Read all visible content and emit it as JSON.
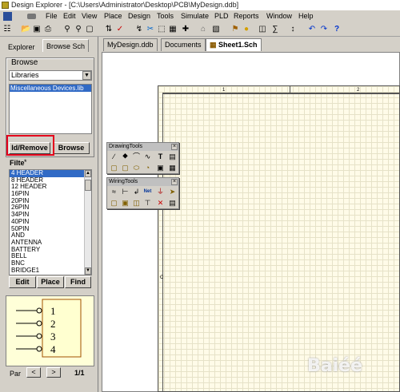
{
  "title": "Design Explorer - [C:\\Users\\Administrator\\Desktop\\PCB\\MyDesign.ddb]",
  "menu": [
    "File",
    "Edit",
    "View",
    "Place",
    "Design",
    "Tools",
    "Simulate",
    "PLD",
    "Reports",
    "Window",
    "Help"
  ],
  "panel": {
    "tabs": [
      "Explorer",
      "Browse Sch"
    ],
    "browse_label": "Browse",
    "libraries_value": "Libraries",
    "library_items": [
      "Miscellaneous Devices.lib"
    ],
    "add_remove_button": "Id/Remove",
    "browse_button": "Browse",
    "filter_label": "Filte",
    "filter_value": "*",
    "components": [
      "4 HEADER",
      "8 HEADER",
      "12 HEADER",
      "16PIN",
      "20PIN",
      "26PIN",
      "34PIN",
      "40PIN",
      "50PIN",
      "AND",
      "ANTENNA",
      "BATTERY",
      "BELL",
      "BNC",
      "BRIDGE1"
    ],
    "edit_button": "Edit",
    "place_button": "Place",
    "find_button": "Find",
    "pins": [
      "1",
      "2",
      "3",
      "4"
    ],
    "part_label": "Par",
    "part_counter": "1/1"
  },
  "doc_tabs": [
    "MyDesign.ddb",
    "Documents",
    "Sheet1.Sch"
  ],
  "palettes": {
    "drawing_title": "DrawingTools",
    "wiring_title": "WiringTools"
  },
  "sheet": {
    "col_markers": [
      "1",
      "2"
    ],
    "row_marker": "C"
  },
  "icons": [
    "app-icon",
    "open-icon",
    "save-icon",
    "print-icon",
    "zoom-in-icon",
    "zoom-out-icon",
    "undo-icon",
    "redo-icon",
    "help-icon"
  ],
  "watermark": "Baiéé"
}
